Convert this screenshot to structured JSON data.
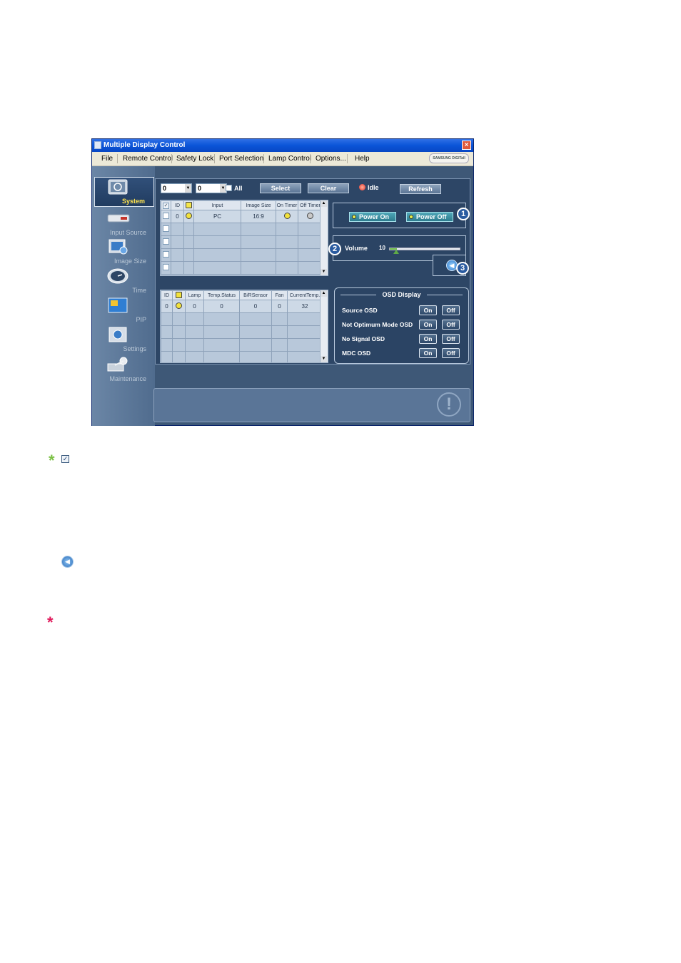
{
  "window": {
    "title": "Multiple Display Control",
    "close": "×",
    "brand": "SAMSUNG DIGITall"
  },
  "menu": [
    "File",
    "Remote Control",
    "Safety Lock",
    "Port Selection",
    "Lamp Control",
    "Options...",
    "Help"
  ],
  "sidebar": {
    "items": [
      {
        "label": "System",
        "active": true,
        "icon": "monitor-icon"
      },
      {
        "label": "Input Source",
        "icon": "input-source-icon"
      },
      {
        "label": "Image Size",
        "icon": "image-size-icon"
      },
      {
        "label": "Time",
        "icon": "clock-icon"
      },
      {
        "label": "PIP",
        "icon": "pip-icon"
      },
      {
        "label": "Settings",
        "icon": "settings-icon"
      },
      {
        "label": "Maintenance",
        "icon": "maintenance-icon"
      }
    ]
  },
  "toolbar": {
    "combo1": "0",
    "combo2": "0",
    "all": "All",
    "select": "Select",
    "clear": "Clear",
    "status": "Idle",
    "refresh": "Refresh"
  },
  "grid1": {
    "headers": [
      "",
      "ID",
      "",
      "Input",
      "Image Size",
      "On Timer",
      "Off Timer"
    ],
    "row": {
      "id": "0",
      "input": "PC",
      "image_size": "16:9"
    }
  },
  "grid2": {
    "headers": [
      "ID",
      "",
      "Lamp",
      "Temp.Status",
      "B/RSensor",
      "Fan",
      "CurrentTemp."
    ],
    "row": [
      "0",
      "",
      "0",
      "0",
      "0",
      "0",
      "32"
    ]
  },
  "power": {
    "on": "Power On",
    "off": "Power Off"
  },
  "volume": {
    "label": "Volume",
    "value": "10",
    "level": 10
  },
  "osd": {
    "title": "OSD Display",
    "rows": [
      {
        "name": "Source OSD",
        "on": "On",
        "off": "Off"
      },
      {
        "name": "Not Optimum Mode OSD",
        "on": "On",
        "off": "Off"
      },
      {
        "name": "No Signal OSD",
        "on": "On",
        "off": "Off"
      },
      {
        "name": "MDC OSD",
        "on": "On",
        "off": "Off"
      }
    ]
  },
  "callouts": [
    "1",
    "2",
    "3"
  ],
  "glyphs": {
    "green_star": "*",
    "check": "✓",
    "speaker": "◀",
    "red_star": "*",
    "mute": "◀",
    "warn": "!"
  }
}
